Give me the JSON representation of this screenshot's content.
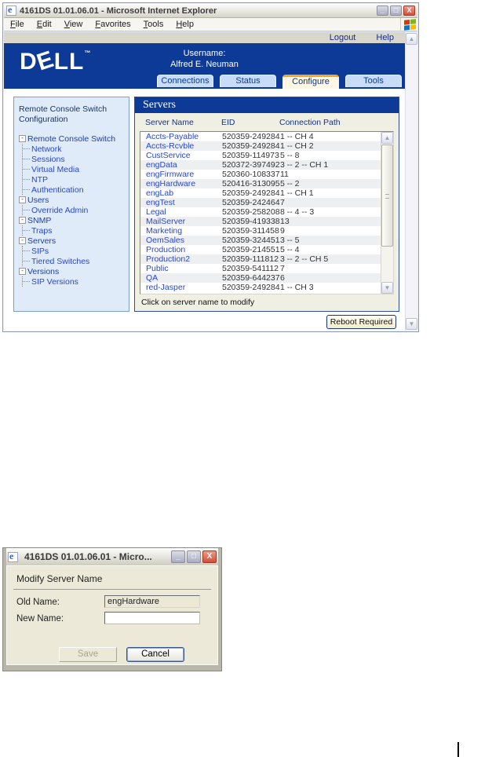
{
  "main_window": {
    "title": "4161DS 01.01.06.01 - Microsoft Internet Explorer",
    "menu": [
      "File",
      "Edit",
      "View",
      "Favorites",
      "Tools",
      "Help"
    ],
    "window_buttons": {
      "minimize": "_",
      "maximize": "□",
      "close": "X"
    },
    "links": {
      "logout": "Logout",
      "help": "Help"
    },
    "brand": {
      "logo_d": "D",
      "logo_e": "E",
      "logo_ll": "LL",
      "logo_tm": "™",
      "username_label": "Username:",
      "username": "Alfred E. Neuman"
    },
    "tabs": [
      {
        "label": "Connections",
        "active": false
      },
      {
        "label": "Status",
        "active": false
      },
      {
        "label": "Configure",
        "active": true
      },
      {
        "label": "Tools",
        "active": false
      }
    ],
    "sidebar": {
      "title_line1": "Remote Console Switch",
      "title_line2": "Configuration",
      "tree": [
        {
          "label": "Remote Console Switch",
          "children": [
            "Network",
            "Sessions",
            "Virtual Media",
            "NTP",
            "Authentication"
          ]
        },
        {
          "label": "Users",
          "children": [
            "Override Admin"
          ]
        },
        {
          "label": "SNMP",
          "children": [
            "Traps"
          ]
        },
        {
          "label": "Servers",
          "children": [
            "SIPs",
            "Tiered Switches"
          ]
        },
        {
          "label": "Versions",
          "children": [
            "SIP Versions"
          ]
        }
      ]
    },
    "panel": {
      "title": "Servers",
      "columns": [
        "Server Name",
        "EID",
        "Connection Path"
      ],
      "rows": [
        [
          "Accts-Payable",
          "520359-249284",
          "1 -- CH 4"
        ],
        [
          "Accts-Rcvble",
          "520359-249284",
          "1 -- CH 2"
        ],
        [
          "CustService",
          "520359-114973",
          "5 -- 8"
        ],
        [
          "engData",
          "520372-397492",
          "3 -- 2 -- CH 1"
        ],
        [
          "engFirmware",
          "520360-108337",
          "11"
        ],
        [
          "engHardware",
          "520416-313095",
          "5 -- 2"
        ],
        [
          "engLab",
          "520359-249284",
          "1 -- CH 1"
        ],
        [
          "engTest",
          "520359-242464",
          "7"
        ],
        [
          "Legal",
          "520359-258208",
          "8 -- 4 -- 3"
        ],
        [
          "MailServer",
          "520359-419338",
          "13"
        ],
        [
          "Marketing",
          "520359-311458",
          "9"
        ],
        [
          "OemSales",
          "520359-324451",
          "3 -- 5"
        ],
        [
          "Production",
          "520359-214551",
          "5 -- 4"
        ],
        [
          "Production2",
          "520359-111812",
          "3 -- 2 -- CH 5"
        ],
        [
          "Public",
          "520359-541112",
          "7"
        ],
        [
          "QA",
          "520359-644237",
          "6"
        ],
        [
          "red-Jasper",
          "520359-249284",
          "1 -- CH 3"
        ]
      ],
      "hint": "Click on server name to modify",
      "reboot_button": "Reboot Required"
    }
  },
  "dialog": {
    "title": "4161DS 01.01.06.01 - Micro...",
    "window_buttons": {
      "minimize": "_",
      "maximize": "□",
      "close": "X"
    },
    "heading": "Modify Server Name",
    "old_name_label": "Old Name:",
    "old_name_value": "engHardware",
    "new_name_label": "New Name:",
    "new_name_value": "",
    "save_label": "Save",
    "cancel_label": "Cancel"
  },
  "colors": {
    "dell_blue": "#0c3a96",
    "tab_active_accent": "#f5a623",
    "tab_inactive_bg": "#c8dcf8",
    "link_blue": "#2947c8",
    "header_navy": "#16357e",
    "sidebar_bg": "#e0ebfa",
    "panel_bg": "#f0efe4",
    "dialog_bg": "#ece9d8",
    "strip_gray": "#d9d6cb",
    "reboot_button_bg": "#f9f3cf",
    "close_button_red": "#d05038"
  }
}
